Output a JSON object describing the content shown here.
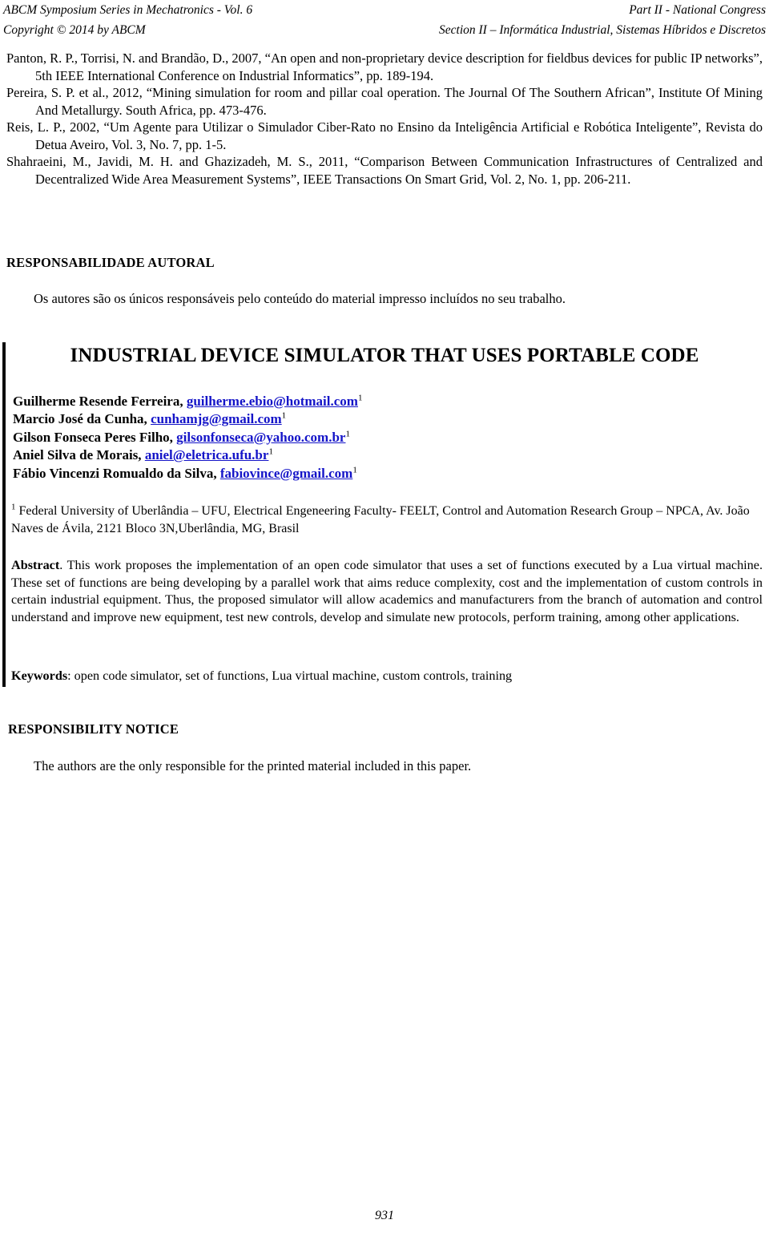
{
  "running_header": {
    "left_line1": "ABCM Symposium Series in Mechatronics - Vol. 6",
    "left_line2": "Copyright © 2014 by ABCM",
    "right_line1": "Part II - National Congress",
    "right_line2": "Section II – Informática Industrial, Sistemas Híbridos e Discretos"
  },
  "references": [
    "Panton, R. P., Torrisi, N. and Brandão, D., 2007, “An open and non-proprietary device description for fieldbus devices for public IP networks”, 5th IEEE International Conference on Industrial Informatics”, pp. 189-194.",
    "Pereira, S. P. et al., 2012, “Mining simulation for room and pillar coal operation. The Journal Of The Southern African”, Institute Of Mining And Metallurgy. South Africa, pp. 473-476.",
    "Reis, L. P., 2002, “Um Agente para Utilizar o Simulador Ciber-Rato no Ensino da Inteligência Artificial e Robótica Inteligente”, Revista do Detua Aveiro, Vol. 3, No. 7, pp. 1-5.",
    "Shahraeini, M., Javidi, M. H. and Ghazizadeh, M. S., 2011, “Comparison Between Communication Infrastructures of Centralized and Decentralized Wide Area Measurement Systems”, IEEE Transactions On Smart Grid, Vol. 2, No. 1, pp. 206-211."
  ],
  "responsabilidade_autoral": {
    "heading": "RESPONSABILIDADE AUTORAL",
    "body": "Os autores são os únicos responsáveis pelo conteúdo do material impresso incluídos no seu trabalho."
  },
  "paper": {
    "title": "INDUSTRIAL DEVICE SIMULATOR THAT USES PORTABLE CODE",
    "authors": [
      {
        "name": "Guilherme Resende Ferreira,",
        "email": "guilherme.ebio@hotmail.com",
        "mark": "1"
      },
      {
        "name": "Marcio José da Cunha,",
        "email": "cunhamjg@gmail.com",
        "mark": "1"
      },
      {
        "name": "Gilson Fonseca Peres Filho,",
        "email": "gilsonfonseca@yahoo.com.br",
        "mark": "1"
      },
      {
        "name": "Aniel Silva de Morais,",
        "email": "aniel@eletrica.ufu.br",
        "mark": "1"
      },
      {
        "name": "Fábio Vincenzi Romualdo da Silva,",
        "email": "fabiovince@gmail.com",
        "mark": "1"
      }
    ],
    "affiliation_mark": "1",
    "affiliation": "Federal University of Uberlândia – UFU, Electrical Engeneering Faculty- FEELT, Control and Automation Research Group – NPCA,  Av. João Naves de Ávila, 2121 Bloco 3N,Uberlândia, MG, Brasil",
    "abstract_label": "Abstract",
    "abstract_body": ". This work proposes the implementation of an open code simulator that uses a set of functions executed by a Lua virtual machine. These set of functions are being developing by a parallel work that aims reduce complexity, cost and the implementation of custom controls in certain industrial equipment. Thus, the proposed simulator will allow academics and manufacturers from the branch of automation and control understand and improve new equipment, test new controls, develop and simulate new protocols, perform training, among other applications.",
    "keywords_label": "Keywords",
    "keywords_body": ":  open code simulator, set of functions, Lua virtual machine, custom controls, training"
  },
  "responsibility_notice": {
    "heading": "RESPONSIBILITY NOTICE",
    "body": "The authors are the only responsible for the printed material included in this paper."
  },
  "footer": {
    "page_number": "931"
  },
  "colors": {
    "link": "#1414c8",
    "text": "#000000",
    "change_bar": "#0a0a0a",
    "background": "#ffffff"
  }
}
